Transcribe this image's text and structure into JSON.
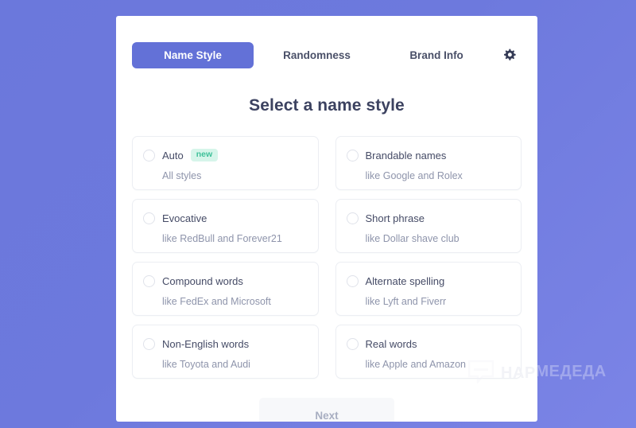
{
  "background": {
    "gradient_from": "#6b78dc",
    "gradient_to": "#7b84e6"
  },
  "watermark": {
    "text": "НАРМЕДЕДА",
    "icon": "speech-bubble-icon"
  },
  "tabs": [
    {
      "label": "Name Style",
      "active": true
    },
    {
      "label": "Randomness",
      "active": false
    },
    {
      "label": "Brand Info",
      "active": false
    }
  ],
  "settings_icon": "gear-icon",
  "page_title": "Select a name style",
  "accent_color": "#6371d7",
  "badge_color": "#3fc19a",
  "options": [
    {
      "label": "Auto",
      "badge": "new",
      "sub": "All styles",
      "selected": false
    },
    {
      "label": "Brandable names",
      "badge": null,
      "sub": "like Google and Rolex",
      "selected": false
    },
    {
      "label": "Evocative",
      "badge": null,
      "sub": "like RedBull and Forever21",
      "selected": false
    },
    {
      "label": "Short phrase",
      "badge": null,
      "sub": "like Dollar shave club",
      "selected": false
    },
    {
      "label": "Compound words",
      "badge": null,
      "sub": "like FedEx and Microsoft",
      "selected": false
    },
    {
      "label": "Alternate spelling",
      "badge": null,
      "sub": "like Lyft and Fiverr",
      "selected": false
    },
    {
      "label": "Non-English words",
      "badge": null,
      "sub": "like Toyota and Audi",
      "selected": false
    },
    {
      "label": "Real words",
      "badge": null,
      "sub": "like Apple and Amazon",
      "selected": false
    }
  ],
  "footer": {
    "next_label": "Next",
    "next_disabled": true
  }
}
